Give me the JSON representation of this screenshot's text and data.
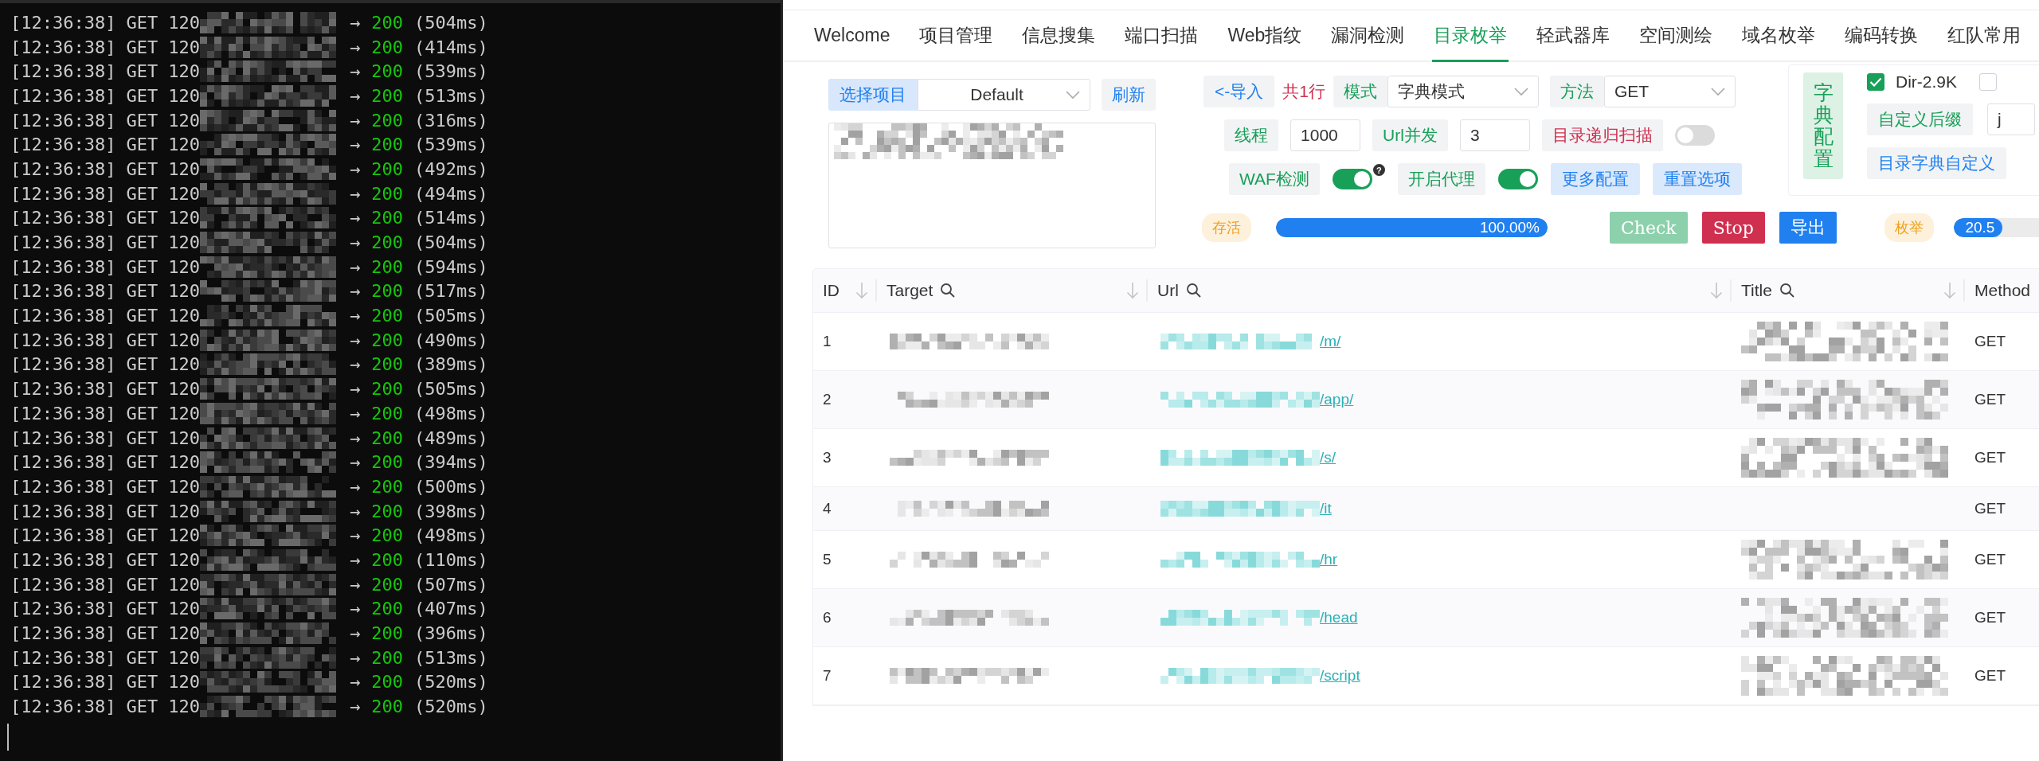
{
  "terminal": {
    "lines": [
      {
        "time": "[12:36:38]",
        "method": "GET",
        "host": "120",
        "arrow": "→",
        "status": "200",
        "duration": "(504ms)"
      },
      {
        "time": "[12:36:38]",
        "method": "GET",
        "host": "120",
        "arrow": "→",
        "status": "200",
        "duration": "(414ms)"
      },
      {
        "time": "[12:36:38]",
        "method": "GET",
        "host": "120",
        "arrow": "→",
        "status": "200",
        "duration": "(539ms)"
      },
      {
        "time": "[12:36:38]",
        "method": "GET",
        "host": "120",
        "arrow": "→",
        "status": "200",
        "duration": "(513ms)"
      },
      {
        "time": "[12:36:38]",
        "method": "GET",
        "host": "120",
        "arrow": "→",
        "status": "200",
        "duration": "(316ms)"
      },
      {
        "time": "[12:36:38]",
        "method": "GET",
        "host": "120",
        "arrow": "→",
        "status": "200",
        "duration": "(539ms)"
      },
      {
        "time": "[12:36:38]",
        "method": "GET",
        "host": "120",
        "arrow": "→",
        "status": "200",
        "duration": "(492ms)"
      },
      {
        "time": "[12:36:38]",
        "method": "GET",
        "host": "120",
        "arrow": "→",
        "status": "200",
        "duration": "(494ms)"
      },
      {
        "time": "[12:36:38]",
        "method": "GET",
        "host": "120",
        "arrow": "→",
        "status": "200",
        "duration": "(514ms)"
      },
      {
        "time": "[12:36:38]",
        "method": "GET",
        "host": "120",
        "arrow": "→",
        "status": "200",
        "duration": "(504ms)"
      },
      {
        "time": "[12:36:38]",
        "method": "GET",
        "host": "120",
        "arrow": "→",
        "status": "200",
        "duration": "(594ms)"
      },
      {
        "time": "[12:36:38]",
        "method": "GET",
        "host": "120",
        "arrow": "→",
        "status": "200",
        "duration": "(517ms)"
      },
      {
        "time": "[12:36:38]",
        "method": "GET",
        "host": "120",
        "arrow": "→",
        "status": "200",
        "duration": "(505ms)"
      },
      {
        "time": "[12:36:38]",
        "method": "GET",
        "host": "120",
        "arrow": "→",
        "status": "200",
        "duration": "(490ms)"
      },
      {
        "time": "[12:36:38]",
        "method": "GET",
        "host": "120",
        "arrow": "→",
        "status": "200",
        "duration": "(389ms)"
      },
      {
        "time": "[12:36:38]",
        "method": "GET",
        "host": "120",
        "arrow": "→",
        "status": "200",
        "duration": "(505ms)"
      },
      {
        "time": "[12:36:38]",
        "method": "GET",
        "host": "120",
        "arrow": "→",
        "status": "200",
        "duration": "(498ms)"
      },
      {
        "time": "[12:36:38]",
        "method": "GET",
        "host": "120",
        "arrow": "→",
        "status": "200",
        "duration": "(489ms)"
      },
      {
        "time": "[12:36:38]",
        "method": "GET",
        "host": "120",
        "arrow": "→",
        "status": "200",
        "duration": "(394ms)"
      },
      {
        "time": "[12:36:38]",
        "method": "GET",
        "host": "120",
        "arrow": "→",
        "status": "200",
        "duration": "(500ms)"
      },
      {
        "time": "[12:36:38]",
        "method": "GET",
        "host": "120",
        "arrow": "→",
        "status": "200",
        "duration": "(398ms)"
      },
      {
        "time": "[12:36:38]",
        "method": "GET",
        "host": "120",
        "arrow": "→",
        "status": "200",
        "duration": "(498ms)"
      },
      {
        "time": "[12:36:38]",
        "method": "GET",
        "host": "120",
        "arrow": "→",
        "status": "200",
        "duration": "(110ms)"
      },
      {
        "time": "[12:36:38]",
        "method": "GET",
        "host": "120",
        "arrow": "→",
        "status": "200",
        "duration": "(507ms)"
      },
      {
        "time": "[12:36:38]",
        "method": "GET",
        "host": "120",
        "arrow": "→",
        "status": "200",
        "duration": "(407ms)"
      },
      {
        "time": "[12:36:38]",
        "method": "GET",
        "host": "120",
        "arrow": "→",
        "status": "200",
        "duration": "(396ms)"
      },
      {
        "time": "[12:36:38]",
        "method": "GET",
        "host": "120",
        "arrow": "→",
        "status": "200",
        "duration": "(513ms)"
      },
      {
        "time": "[12:36:38]",
        "method": "GET",
        "host": "120",
        "arrow": "→",
        "status": "200",
        "duration": "(520ms)"
      },
      {
        "time": "[12:36:38]",
        "method": "GET",
        "host": "120",
        "arrow": "→",
        "status": "200",
        "duration": "(520ms)"
      }
    ]
  },
  "app": {
    "tabs": [
      {
        "label": "Welcome",
        "selected": false
      },
      {
        "label": "项目管理",
        "selected": false
      },
      {
        "label": "信息搜集",
        "selected": false
      },
      {
        "label": "端口扫描",
        "selected": false
      },
      {
        "label": "Web指纹",
        "selected": false
      },
      {
        "label": "漏洞检测",
        "selected": false
      },
      {
        "label": "目录枚举",
        "selected": true
      },
      {
        "label": "轻武器库",
        "selected": false
      },
      {
        "label": "空间测绘",
        "selected": false
      },
      {
        "label": "域名枚举",
        "selected": false
      },
      {
        "label": "编码转换",
        "selected": false
      },
      {
        "label": "红队常用",
        "selected": false
      }
    ],
    "project": {
      "label": "选择项目",
      "value": "Default",
      "refresh_button": "刷新"
    },
    "import_button": "<-导入",
    "line_count": "共1行",
    "mode": {
      "label": "模式",
      "value": "字典模式"
    },
    "request_method": {
      "label": "方法",
      "value": "GET"
    },
    "threads": {
      "label": "线程",
      "value": "1000"
    },
    "url_concurrency": {
      "label": "Url并发",
      "value": "3"
    },
    "recursive_scan": {
      "label": "目录递归扫描",
      "on": false
    },
    "waf_detect": {
      "label": "WAF检测",
      "on": true,
      "help": "?"
    },
    "proxy": {
      "label": "开启代理",
      "on": true
    },
    "more_button": "更多配置",
    "reset_button": "重置选项",
    "alive": {
      "badge": "存活",
      "level": 1,
      "reading": "100.00%"
    },
    "actions": [
      {
        "label": "Check",
        "kind": "check",
        "disabled": true
      },
      {
        "label": "Stop",
        "kind": "stop",
        "disabled": false
      },
      {
        "label": "导出",
        "kind": "export",
        "disabled": false
      }
    ],
    "enumeration": {
      "badge": "枚举",
      "level": 0.205,
      "reading": "20.5"
    },
    "dict_config": {
      "title": "字典配置",
      "dicts": [
        {
          "label": "Dir-2.9K",
          "checked": true
        },
        {
          "checked": false
        }
      ],
      "suffix_button": "自定义后缀",
      "suffix_value": "j",
      "custom_button": "目录字典自定义"
    },
    "table": {
      "columns": [
        {
          "label": "ID",
          "searchable": false,
          "sortable": true
        },
        {
          "label": "Target",
          "searchable": true,
          "sortable": true
        },
        {
          "label": "Url",
          "searchable": true,
          "sortable": true
        },
        {
          "label": "Title",
          "searchable": true,
          "sortable": true
        },
        {
          "label": "Method",
          "searchable": false,
          "sortable": false
        }
      ],
      "rows": [
        {
          "id": "1",
          "url_path": "/m/",
          "title_blurred": true,
          "method": "GET"
        },
        {
          "id": "2",
          "url_path": "/app/",
          "title_blurred": true,
          "method": "GET"
        },
        {
          "id": "3",
          "url_path": "/s/",
          "title_blurred": true,
          "method": "GET"
        },
        {
          "id": "4",
          "url_path": "/it",
          "title_blurred": false,
          "method": "GET"
        },
        {
          "id": "5",
          "url_path": "/hr",
          "title_blurred": true,
          "method": "GET"
        },
        {
          "id": "6",
          "url_path": "/head",
          "title_blurred": true,
          "method": "GET"
        },
        {
          "id": "7",
          "url_path": "/script",
          "title_blurred": true,
          "method": "GET"
        }
      ]
    }
  }
}
